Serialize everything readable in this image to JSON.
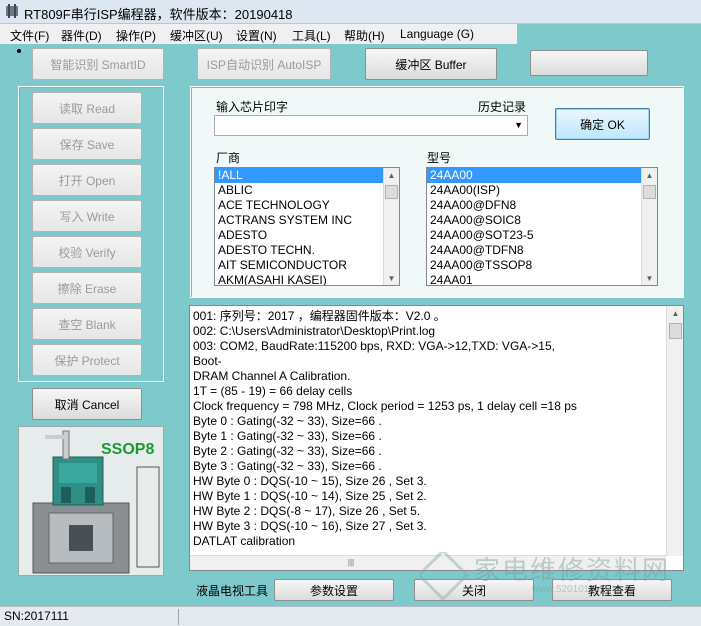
{
  "window": {
    "title": "RT809F串行ISP编程器，软件版本：20190418"
  },
  "menu": [
    "文件(F)",
    "器件(D)",
    "操作(P)",
    "缓冲区(U)",
    "设置(N)",
    "工具(L)",
    "帮助(H)",
    "Language (G)"
  ],
  "top_buttons": {
    "smartid": "智能识别 SmartID",
    "isp_auto": "ISP自动识别 AutoISP",
    "buffer": "缓冲区 Buffer"
  },
  "ops": [
    "读取 Read",
    "保存 Save",
    "打开 Open",
    "写入 Write",
    "校验 Verify",
    "擦除 Erase",
    "查空 Blank",
    "保护 Protect"
  ],
  "cancel_button": "取消 Cancel",
  "socket_label": "SSOP8",
  "chip": {
    "input_label": "输入芯片印字",
    "history_label": "历史记录",
    "input_value": "",
    "ok_button": "确定 OK",
    "vendor_label": "厂商",
    "model_label": "型号",
    "vendors": [
      "!ALL",
      "ABLIC",
      "ACE TECHNOLOGY",
      "ACTRANS SYSTEM INC",
      "ADESTO",
      "ADESTO TECHN.",
      "AIT SEMICONDUCTOR",
      "AKM(ASAHI KASEI)"
    ],
    "models": [
      "24AA00",
      "24AA00(ISP)",
      "24AA00@DFN8",
      "24AA00@SOIC8",
      "24AA00@SOT23-5",
      "24AA00@TDFN8",
      "24AA00@TSSOP8",
      "24AA01"
    ]
  },
  "log_lines": [
    "001:  序列号：2017                         ，编程器固件版本：V2.0 。",
    "002:  C:\\Users\\Administrator\\Desktop\\Print.log",
    "003:  COM2, BaudRate:115200 bps, RXD: VGA->12,TXD: VGA->15,",
    "Boot-",
    "DRAM Channel A Calibration.",
    "1T = (85 - 19) = 66 delay cells",
    "Clock frequency = 798 MHz, Clock period = 1253 ps, 1 delay cell =18 ps",
    "Byte 0 : Gating(-32 ~ 33), Size=66 .",
    "Byte 1 : Gating(-32 ~ 33), Size=66 .",
    "Byte 2 : Gating(-32 ~ 33), Size=66 .",
    "Byte 3 : Gating(-32 ~ 33), Size=66 .",
    "HW Byte 0 : DQS(-10 ~ 15), Size 26 , Set 3.",
    "HW Byte 1 : DQS(-10 ~ 14), Size 25 , Set 2.",
    "HW Byte 2 : DQS(-8 ~ 17), Size 26 , Set 5.",
    "HW Byte 3 : DQS(-10 ~ 16), Size 27 , Set 3.",
    "DATLAT calibration"
  ],
  "bottom": {
    "tv_tools": "液晶电视工具",
    "params": "参数设置",
    "close": "关闭",
    "tutorial": "教程查看"
  },
  "statusbar": {
    "sn": "SN:2017111"
  },
  "watermark": {
    "text": "家电维修资料网",
    "url": "www.520101.com"
  }
}
